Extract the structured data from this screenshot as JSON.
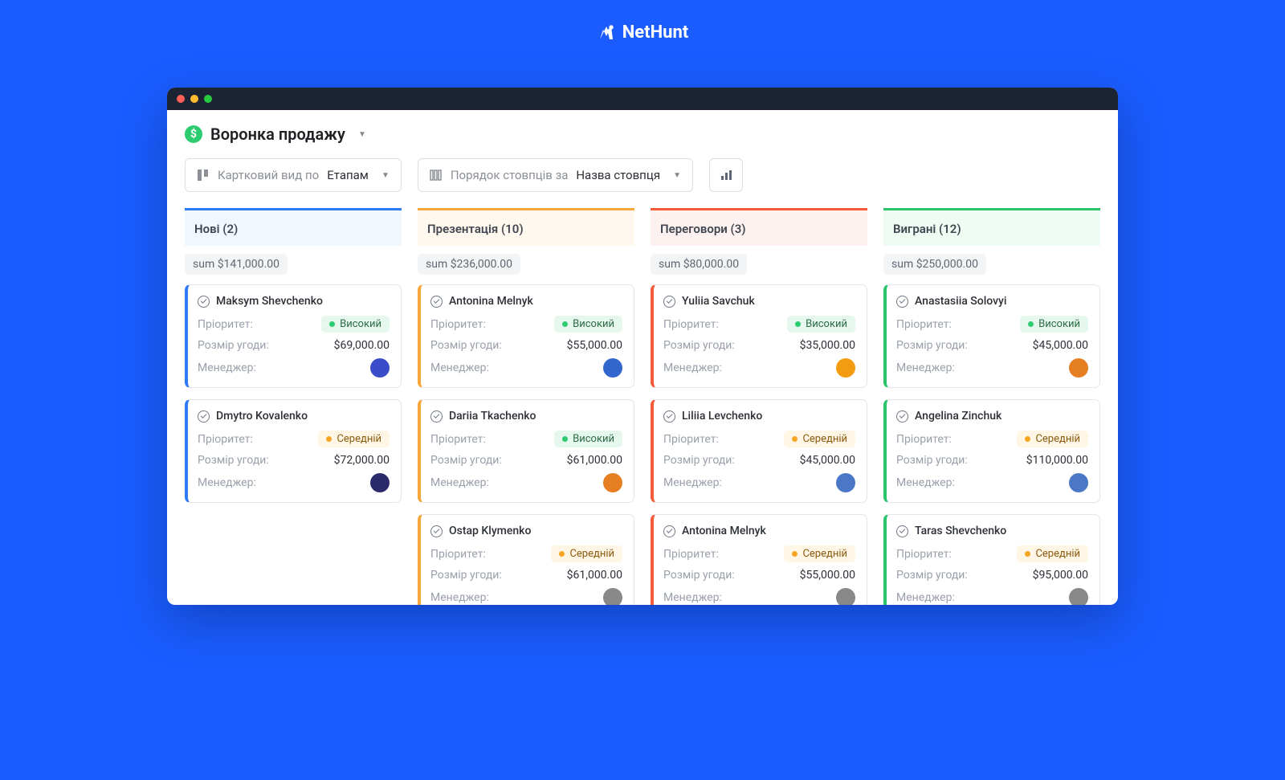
{
  "brand": "NetHunt",
  "pageTitle": "Воронка продажу",
  "controls": {
    "cardViewLabel": "Картковий вид по",
    "cardViewValue": "Етапам",
    "orderLabel": "Порядок стовпців за",
    "orderValue": "Назва стовпця"
  },
  "labels": {
    "priority": "Пріоритет:",
    "dealSize": "Розмір угоди:",
    "manager": "Менеджер:",
    "sumPrefix": "sum"
  },
  "priorities": {
    "high": "Високий",
    "medium": "Середній"
  },
  "columns": [
    {
      "title": "Нові (2)",
      "colorClass": "col-blue",
      "cardClass": "blue",
      "sum": "$141,000.00",
      "cards": [
        {
          "name": "Maksym Shevchenko",
          "priority": "high",
          "deal": "$69,000.00",
          "avatar": "#3b4cca"
        },
        {
          "name": "Dmytro Kovalenko",
          "priority": "medium",
          "deal": "$72,000.00",
          "avatar": "#2b2b6b"
        }
      ]
    },
    {
      "title": "Презентація (10)",
      "colorClass": "col-orange",
      "cardClass": "orange",
      "sum": "$236,000.00",
      "cards": [
        {
          "name": "Antonina Melnyk",
          "priority": "high",
          "deal": "$55,000.00",
          "avatar": "#3366cc"
        },
        {
          "name": "Dariia Tkachenko",
          "priority": "high",
          "deal": "$61,000.00",
          "avatar": "#e67e22"
        },
        {
          "name": "Ostap Klymenko",
          "priority": "medium",
          "deal": "$61,000.00",
          "avatar": "#888"
        }
      ]
    },
    {
      "title": "Переговори (3)",
      "colorClass": "col-red",
      "cardClass": "red",
      "sum": "$80,000.00",
      "cards": [
        {
          "name": "Yuliia Savchuk",
          "priority": "high",
          "deal": "$35,000.00",
          "avatar": "#f39c12"
        },
        {
          "name": "Liliia Levchenko",
          "priority": "medium",
          "deal": "$45,000.00",
          "avatar": "#4a78c7"
        },
        {
          "name": "Antonina Melnyk",
          "priority": "medium",
          "deal": "$55,000.00",
          "avatar": "#888"
        }
      ]
    },
    {
      "title": "Виграні (12)",
      "colorClass": "col-green",
      "cardClass": "green",
      "sum": "$250,000.00",
      "cards": [
        {
          "name": "Anastasiia Solovyi",
          "priority": "high",
          "deal": "$45,000.00",
          "avatar": "#e67e22"
        },
        {
          "name": "Angelina Zinchuk",
          "priority": "medium",
          "deal": "$110,000.00",
          "avatar": "#4a78c7"
        },
        {
          "name": "Taras Shevchenko",
          "priority": "medium",
          "deal": "$95,000.00",
          "avatar": "#888"
        }
      ]
    }
  ]
}
